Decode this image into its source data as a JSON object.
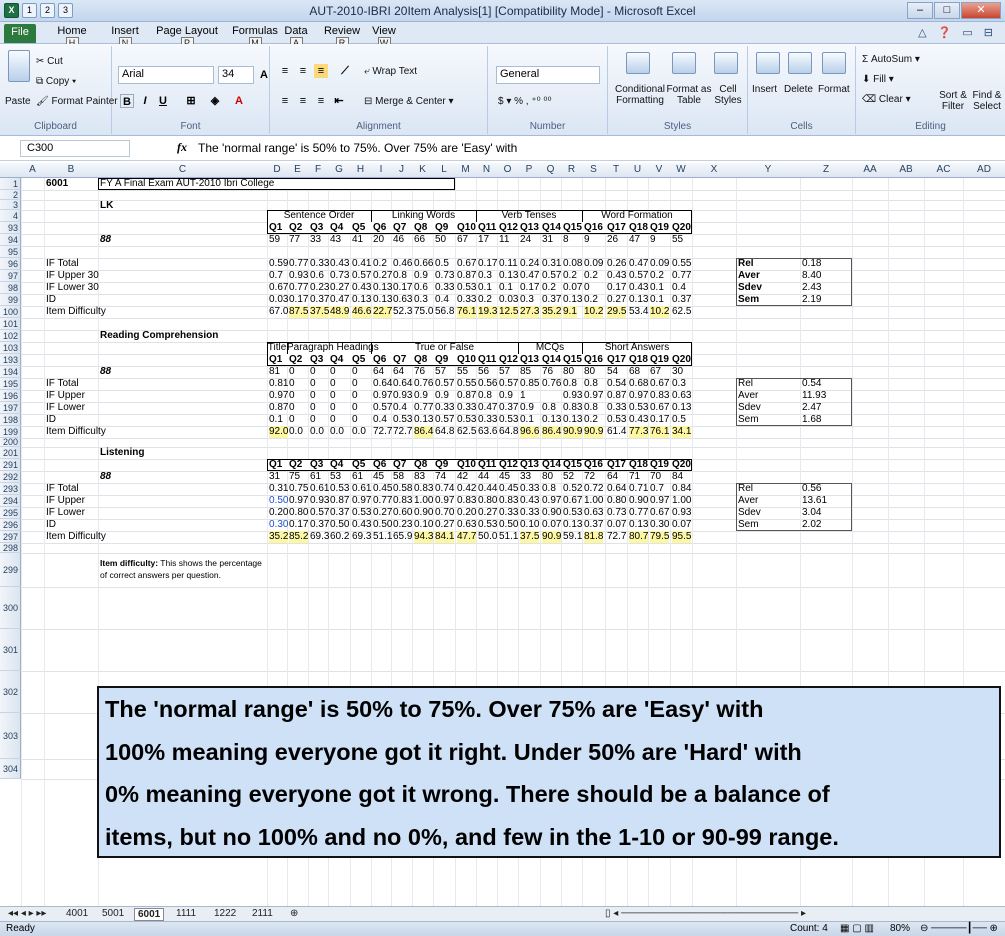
{
  "window": {
    "title": "AUT-2010-IBRI 20Item Analysis[1] [Compatibility Mode] - Microsoft Excel"
  },
  "qat_keytips": [
    "1",
    "2",
    "3"
  ],
  "tabs": [
    {
      "label": "File",
      "key": "F"
    },
    {
      "label": "Home",
      "key": "H"
    },
    {
      "label": "Insert",
      "key": "N"
    },
    {
      "label": "Page Layout",
      "key": "P"
    },
    {
      "label": "Formulas",
      "key": "M"
    },
    {
      "label": "Data",
      "key": "A"
    },
    {
      "label": "Review",
      "key": "R"
    },
    {
      "label": "View",
      "key": "W"
    }
  ],
  "ribbon": {
    "clipboard": {
      "paste": "Paste",
      "cut": "Cut",
      "copy": "Copy",
      "format_painter": "Format Painter",
      "label": "Clipboard"
    },
    "font": {
      "name": "Arial",
      "size": "34",
      "label": "Font"
    },
    "alignment": {
      "wrap": "Wrap Text",
      "merge": "Merge & Center",
      "label": "Alignment"
    },
    "number": {
      "format": "General",
      "label": "Number"
    },
    "styles": {
      "conditional": "Conditional Formatting",
      "format_table": "Format as Table",
      "cell_styles": "Cell Styles",
      "label": "Styles"
    },
    "cells": {
      "insert": "Insert",
      "delete": "Delete",
      "format": "Format",
      "label": "Cells"
    },
    "editing": {
      "autosum": "AutoSum",
      "fill": "Fill",
      "clear": "Clear",
      "sort": "Sort & Filter",
      "find": "Find & Select",
      "label": "Editing"
    }
  },
  "formula_bar": {
    "name_box": "C300",
    "fx": "fx",
    "content": "The 'normal range' is 50% to 75%.  Over 75% are 'Easy' with"
  },
  "columns": [
    "A",
    "B",
    "C",
    "D",
    "E",
    "F",
    "G",
    "H",
    "I",
    "J",
    "K",
    "L",
    "M",
    "N",
    "O",
    "P",
    "Q",
    "R",
    "S",
    "T",
    "U",
    "V",
    "W",
    "X",
    "Y",
    "Z",
    "AA",
    "AB",
    "AC",
    "AD"
  ],
  "sheet": {
    "title_code": "6001",
    "title": "FY A Final Exam AUT-2010 Ibri College",
    "sec1": {
      "name": "LK",
      "groups": [
        "Sentence Order",
        "Linking Words",
        "Verb Tenses",
        "Word Formation"
      ],
      "q": [
        "Q1",
        "Q2",
        "Q3",
        "Q4",
        "Q5",
        "Q6",
        "Q7",
        "Q8",
        "Q9",
        "Q10",
        "Q11",
        "Q12",
        "Q13",
        "Q14",
        "Q15",
        "Q16",
        "Q17",
        "Q18",
        "Q19",
        "Q20"
      ],
      "n": "88",
      "counts": [
        "59",
        "77",
        "33",
        "43",
        "41",
        "20",
        "46",
        "66",
        "50",
        "67",
        "17",
        "11",
        "24",
        "31",
        "8",
        "9",
        "26",
        "47",
        "9",
        "55"
      ],
      "if_total": [
        "0.59",
        "0.77",
        "0.33",
        "0.43",
        "0.41",
        "0.2",
        "0.46",
        "0.66",
        "0.5",
        "0.67",
        "0.17",
        "0.11",
        "0.24",
        "0.31",
        "0.08",
        "0.09",
        "0.26",
        "0.47",
        "0.09",
        "0.55"
      ],
      "if_upper": [
        "0.7",
        "0.93",
        "0.6",
        "0.73",
        "0.57",
        "0.27",
        "0.8",
        "0.9",
        "0.73",
        "0.87",
        "0.3",
        "0.13",
        "0.47",
        "0.57",
        "0.2",
        "0.2",
        "0.43",
        "0.57",
        "0.2",
        "0.77"
      ],
      "if_lower": [
        "0.67",
        "0.77",
        "0.23",
        "0.27",
        "0.43",
        "0.13",
        "0.17",
        "0.6",
        "0.33",
        "0.53",
        "0.1",
        "0.1",
        "0.17",
        "0.2",
        "0.07",
        "0",
        "0.17",
        "0.43",
        "0.1",
        "0.4"
      ],
      "id": [
        "0.03",
        "0.17",
        "0.37",
        "0.47",
        "0.13",
        "0.13",
        "0.63",
        "0.3",
        "0.4",
        "0.33",
        "0.2",
        "0.03",
        "0.3",
        "0.37",
        "0.13",
        "0.2",
        "0.27",
        "0.13",
        "0.1",
        "0.37"
      ],
      "difficulty": [
        "67.0",
        "87.5",
        "37.5",
        "48.9",
        "46.6",
        "22.7",
        "52.3",
        "75.0",
        "56.8",
        "76.1",
        "19.3",
        "12.5",
        "27.3",
        "35.2",
        "9.1",
        "10.2",
        "29.5",
        "53.4",
        "10.2",
        "62.5"
      ],
      "stats": [
        [
          "Rel",
          "0.18"
        ],
        [
          "Aver",
          "8.40"
        ],
        [
          "Sdev",
          "2.43"
        ],
        [
          "Sem",
          "2.19"
        ]
      ]
    },
    "sec2": {
      "name": "Reading Comprehension",
      "groups": [
        "Title",
        "Paragraph Headings",
        "True or False",
        "MCQs",
        "Short Answers"
      ],
      "n": "88",
      "counts": [
        "81",
        "0",
        "0",
        "0",
        "0",
        "64",
        "64",
        "76",
        "57",
        "55",
        "56",
        "57",
        "85",
        "76",
        "80",
        "80",
        "54",
        "68",
        "67",
        "30"
      ],
      "if_total": [
        "0.81",
        "0",
        "0",
        "0",
        "0",
        "0.64",
        "0.64",
        "0.76",
        "0.57",
        "0.55",
        "0.56",
        "0.57",
        "0.85",
        "0.76",
        "0.8",
        "0.8",
        "0.54",
        "0.68",
        "0.67",
        "0.3"
      ],
      "if_upper": [
        "0.97",
        "0",
        "0",
        "0",
        "0",
        "0.97",
        "0.93",
        "0.9",
        "0.9",
        "0.87",
        "0.8",
        "0.9",
        "1",
        "",
        "0.93",
        "0.97",
        "0.87",
        "0.97",
        "0.83",
        "0.63"
      ],
      "if_lower": [
        "0.87",
        "0",
        "0",
        "0",
        "0",
        "0.57",
        "0.4",
        "0.77",
        "0.33",
        "0.33",
        "0.47",
        "0.37",
        "0.9",
        "0.8",
        "0.83",
        "0.8",
        "0.33",
        "0.53",
        "0.67",
        "0.13"
      ],
      "id": [
        "0.1",
        "0",
        "0",
        "0",
        "0",
        "0.4",
        "0.53",
        "0.13",
        "0.57",
        "0.53",
        "0.33",
        "0.53",
        "0.1",
        "0.13",
        "0.13",
        "0.2",
        "0.53",
        "0.43",
        "0.17",
        "0.5"
      ],
      "difficulty": [
        "92.0",
        "0.0",
        "0.0",
        "0.0",
        "0.0",
        "72.7",
        "72.7",
        "86.4",
        "64.8",
        "62.5",
        "63.6",
        "64.8",
        "96.6",
        "86.4",
        "90.9",
        "90.9",
        "61.4",
        "77.3",
        "76.1",
        "34.1"
      ],
      "stats": [
        [
          "Rel",
          "0.54"
        ],
        [
          "Aver",
          "11.93"
        ],
        [
          "Sdev",
          "2.47"
        ],
        [
          "Sem",
          "1.68"
        ]
      ]
    },
    "sec3": {
      "name": "Listening",
      "n": "88",
      "counts": [
        "31",
        "75",
        "61",
        "53",
        "61",
        "45",
        "58",
        "83",
        "74",
        "42",
        "44",
        "45",
        "33",
        "80",
        "52",
        "72",
        "64",
        "71",
        "70",
        "84"
      ],
      "if_total": [
        "0.31",
        "0.75",
        "0.61",
        "0.53",
        "0.61",
        "0.45",
        "0.58",
        "0.83",
        "0.74",
        "0.42",
        "0.44",
        "0.45",
        "0.33",
        "0.8",
        "0.52",
        "0.72",
        "0.64",
        "0.71",
        "0.7",
        "0.84"
      ],
      "if_upper": [
        "0.50",
        "0.97",
        "0.93",
        "0.87",
        "0.97",
        "0.77",
        "0.83",
        "1.00",
        "0.97",
        "0.83",
        "0.80",
        "0.83",
        "0.43",
        "0.97",
        "0.67",
        "1.00",
        "0.80",
        "0.90",
        "0.97",
        "1.00"
      ],
      "if_lower": [
        "0.20",
        "0.80",
        "0.57",
        "0.37",
        "0.53",
        "0.27",
        "0.60",
        "0.90",
        "0.70",
        "0.20",
        "0.27",
        "0.33",
        "0.33",
        "0.90",
        "0.53",
        "0.63",
        "0.73",
        "0.77",
        "0.67",
        "0.93"
      ],
      "id": [
        "0.30",
        "0.17",
        "0.37",
        "0.50",
        "0.43",
        "0.50",
        "0.23",
        "0.10",
        "0.27",
        "0.63",
        "0.53",
        "0.50",
        "0.10",
        "0.07",
        "0.13",
        "0.37",
        "0.07",
        "0.13",
        "0.30",
        "0.07"
      ],
      "difficulty": [
        "35.2",
        "85.2",
        "69.3",
        "60.2",
        "69.3",
        "51.1",
        "65.9",
        "94.3",
        "84.1",
        "47.7",
        "50.0",
        "51.1",
        "37.5",
        "90.9",
        "59.1",
        "81.8",
        "72.7",
        "80.7",
        "79.5",
        "95.5"
      ],
      "stats": [
        [
          "Rel",
          "0.56"
        ],
        [
          "Aver",
          "13.61"
        ],
        [
          "Sdev",
          "3.04"
        ],
        [
          "Sem",
          "2.02"
        ]
      ]
    },
    "labels": {
      "if_total": "IF Total",
      "if_upper30": "IF Upper 30",
      "if_lower30": "IF Lower 30",
      "if_upper": "IF Upper",
      "if_lower": "IF Lower",
      "id": "ID",
      "difficulty": "Item Difficulty"
    },
    "note_small": [
      "Item difficulty: This shows the percentage",
      "of correct answers per question."
    ],
    "note_big": [
      "The 'normal range' is 50% to 75%.  Over 75% are 'Easy' with",
      "100% meaning everyone got it right.  Under 50% are 'Hard' with",
      "0% meaning everyone got it wrong.  There should be a balance of",
      "items, but no 100% and no 0%, and few in the 1-10 or 90-99 range."
    ]
  },
  "rows": [
    "1",
    "2",
    "3",
    "4",
    "93",
    "94",
    "95",
    "96",
    "97",
    "98",
    "99",
    "100",
    "101",
    "102",
    "103",
    "193",
    "194",
    "195",
    "196",
    "197",
    "198",
    "199",
    "200",
    "201",
    "291",
    "292",
    "293",
    "294",
    "295",
    "296",
    "297",
    "298",
    "299",
    "300",
    "301",
    "302",
    "303",
    "304"
  ],
  "sheet_tabs": [
    "4001",
    "5001",
    "6001",
    "1111",
    "1222",
    "2111"
  ],
  "status": {
    "mode": "Ready",
    "count": "Count: 4",
    "zoom": "80%"
  }
}
